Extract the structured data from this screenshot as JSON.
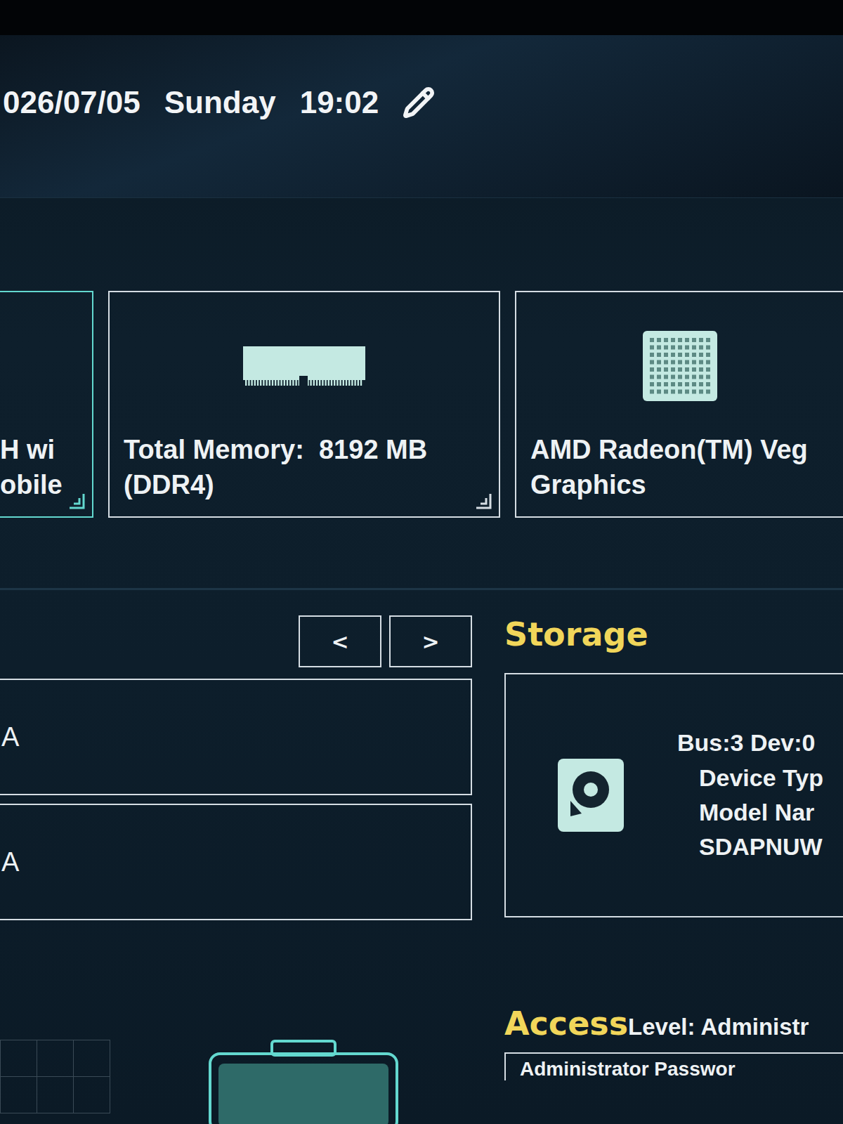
{
  "header": {
    "date": "026/07/05",
    "day": "Sunday",
    "time": "19:02"
  },
  "cards": [
    {
      "kind": "partial",
      "lines": [
        "H wi",
        "obile"
      ],
      "selected": true
    },
    {
      "kind": "memory",
      "lines": [
        "Total Memory:  8192 MB",
        "(DDR4)"
      ],
      "selected": false
    },
    {
      "kind": "gpu",
      "lines": [
        "AMD Radeon(TM) Veg",
        "Graphics"
      ],
      "selected": false
    }
  ],
  "nav": [
    "<",
    ">"
  ],
  "list_items": [
    "A",
    "A"
  ],
  "storage": {
    "title": "Storage",
    "lines": [
      "Bus:3 Dev:0",
      "Device Typ",
      "Model Nar",
      "SDAPNUW"
    ]
  },
  "access": {
    "title": "Access",
    "level": "Level: Administr",
    "field": "Administrator Passwor"
  }
}
